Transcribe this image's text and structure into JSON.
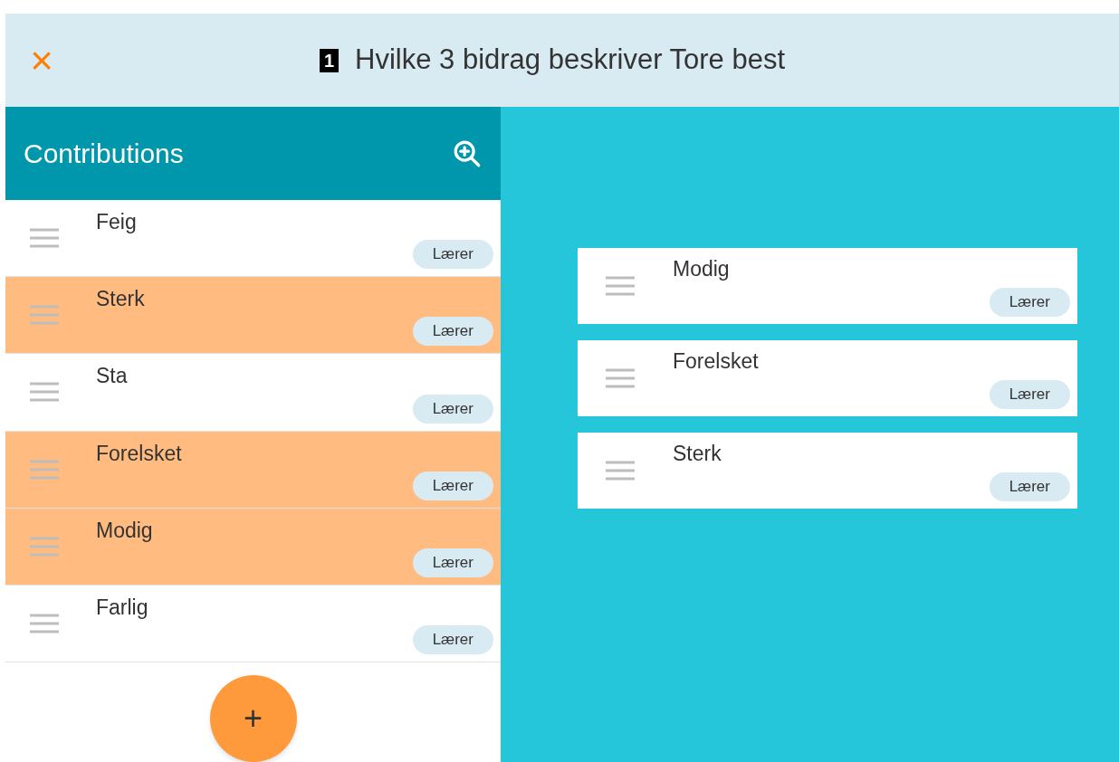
{
  "header": {
    "close_icon_char": "×",
    "number": "1",
    "title": "Hvilke 3 bidrag beskriver Tore best"
  },
  "contributions": {
    "title": "Contributions",
    "items": [
      {
        "text": "Feig",
        "tag": "Lærer",
        "selected": false
      },
      {
        "text": "Sterk",
        "tag": "Lærer",
        "selected": true
      },
      {
        "text": "Sta",
        "tag": "Lærer",
        "selected": false
      },
      {
        "text": "Forelsket",
        "tag": "Lærer",
        "selected": true
      },
      {
        "text": "Modig",
        "tag": "Lærer",
        "selected": true
      },
      {
        "text": "Farlig",
        "tag": "Lærer",
        "selected": false
      }
    ],
    "add_button": "+"
  },
  "answers": [
    {
      "text": "Modig",
      "tag": "Lærer"
    },
    {
      "text": "Forelsket",
      "tag": "Lærer"
    },
    {
      "text": "Sterk",
      "tag": "Lærer"
    }
  ]
}
